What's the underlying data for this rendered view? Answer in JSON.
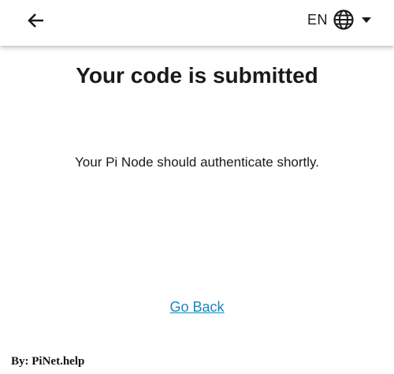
{
  "header": {
    "back_icon": "arrow-left-icon",
    "language_code": "EN",
    "language_icon": "globe-icon",
    "dropdown_icon": "caret-down-icon"
  },
  "main": {
    "title": "Your code is submitted",
    "message": "Your Pi Node should authenticate shortly.",
    "go_back_label": "Go Back"
  },
  "watermark": {
    "text": "By: PiNet.help"
  },
  "colors": {
    "background": "#ffffff",
    "text": "#1a1a1a",
    "link": "#1a86b8"
  }
}
